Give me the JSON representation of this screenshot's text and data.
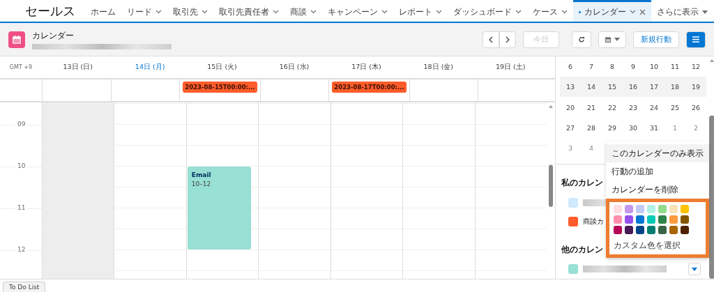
{
  "nav": {
    "app_name": "セールス",
    "items": [
      {
        "label": "ホーム",
        "has_menu": false,
        "selected": false
      },
      {
        "label": "リード",
        "has_menu": true,
        "selected": false
      },
      {
        "label": "取引先",
        "has_menu": true,
        "selected": false
      },
      {
        "label": "取引先責任者",
        "has_menu": true,
        "selected": false
      },
      {
        "label": "商談",
        "has_menu": true,
        "selected": false
      },
      {
        "label": "キャンペーン",
        "has_menu": true,
        "selected": false
      },
      {
        "label": "レポート",
        "has_menu": true,
        "selected": false
      },
      {
        "label": "ダッシュボード",
        "has_menu": true,
        "selected": false
      },
      {
        "label": "ケース",
        "has_menu": true,
        "selected": false
      },
      {
        "label": "カレンダー",
        "has_menu": true,
        "selected": true
      }
    ],
    "more": "さらに表示"
  },
  "header": {
    "title": "カレンダー",
    "today_button": {
      "label": "今日",
      "disabled": true
    },
    "new_button": "新規行動"
  },
  "calendar": {
    "timezone": "GMT +9",
    "days": [
      {
        "label": "13日 (日)",
        "today": false,
        "shaded": true
      },
      {
        "label": "14日 (月)",
        "today": true,
        "shaded": false
      },
      {
        "label": "15日 (火)",
        "today": false,
        "shaded": false,
        "all_day": [
          {
            "text": "2023-08-15T00:00:...",
            "color": "#fe5c2a"
          }
        ],
        "events": [
          {
            "title": "Email",
            "time": "10–12",
            "color": "#97e0d3"
          }
        ]
      },
      {
        "label": "16日 (水)",
        "today": false,
        "shaded": false
      },
      {
        "label": "17日 (木)",
        "today": false,
        "shaded": false,
        "all_day": [
          {
            "text": "2023-08-17T00:00:...",
            "color": "#fe5c2a"
          }
        ]
      },
      {
        "label": "18日 (金)",
        "today": false,
        "shaded": false
      },
      {
        "label": "19日 (土)",
        "today": false,
        "shaded": false
      }
    ],
    "hours": [
      "09",
      "10",
      "11",
      "12"
    ]
  },
  "sidebar": {
    "weeks": [
      {
        "selected": false,
        "days": [
          {
            "label": "6",
            "muted": false
          },
          {
            "label": "7",
            "muted": false
          },
          {
            "label": "8",
            "muted": false
          },
          {
            "label": "9",
            "muted": false
          },
          {
            "label": "10",
            "muted": false
          },
          {
            "label": "11",
            "muted": false
          },
          {
            "label": "12",
            "muted": false
          }
        ]
      },
      {
        "selected": true,
        "days": [
          {
            "label": "13",
            "muted": false
          },
          {
            "label": "14",
            "muted": false
          },
          {
            "label": "15",
            "muted": false
          },
          {
            "label": "16",
            "muted": false
          },
          {
            "label": "17",
            "muted": false
          },
          {
            "label": "18",
            "muted": false
          },
          {
            "label": "19",
            "muted": false
          }
        ]
      },
      {
        "selected": false,
        "days": [
          {
            "label": "20",
            "muted": false
          },
          {
            "label": "21",
            "muted": false
          },
          {
            "label": "22",
            "muted": false
          },
          {
            "label": "23",
            "muted": false
          },
          {
            "label": "24",
            "muted": false
          },
          {
            "label": "25",
            "muted": false
          },
          {
            "label": "26",
            "muted": false
          }
        ]
      },
      {
        "selected": false,
        "days": [
          {
            "label": "27",
            "muted": false
          },
          {
            "label": "28",
            "muted": false
          },
          {
            "label": "29",
            "muted": false
          },
          {
            "label": "30",
            "muted": false
          },
          {
            "label": "31",
            "muted": false
          },
          {
            "label": "1",
            "muted": true
          },
          {
            "label": "2",
            "muted": true
          }
        ]
      },
      {
        "selected": false,
        "days": [
          {
            "label": "3",
            "muted": true
          },
          {
            "label": "4",
            "muted": true
          }
        ]
      }
    ],
    "my_calendars": {
      "title": "私のカレン",
      "items": [
        {
          "color": "#cfe9fe"
        },
        {
          "name": "商談カ",
          "color": "#fe5c2a"
        }
      ]
    },
    "other_calendars": {
      "title": "他のカレン",
      "items": [
        {
          "color": "#97e0d3"
        }
      ]
    }
  },
  "menu": {
    "items": [
      {
        "label": "このカレンダーのみ表示",
        "selected": true
      },
      {
        "label": "行動の追加",
        "selected": false
      },
      {
        "label": "カレンダーを削除",
        "selected": false
      }
    ],
    "colors": [
      {
        "color": "#ffdde1"
      },
      {
        "color": "#c398ed"
      },
      {
        "color": "#c2c9f5"
      },
      {
        "color": "#b1f1e4"
      },
      {
        "color": "#91db8b"
      },
      {
        "color": "#f9e3b6"
      },
      {
        "color": "#ffc100"
      },
      {
        "color": "#ff8fae"
      },
      {
        "color": "#9550ea"
      },
      {
        "color": "#0176d3"
      },
      {
        "color": "#06c9b8"
      },
      {
        "color": "#2e844a"
      },
      {
        "color": "#ff9a3c"
      },
      {
        "color": "#845500"
      },
      {
        "color": "#b60554"
      },
      {
        "color": "#481a54"
      },
      {
        "color": "#014486"
      },
      {
        "color": "#047e70"
      },
      {
        "color": "#396547"
      },
      {
        "color": "#a96404"
      },
      {
        "color": "#4f2100"
      }
    ],
    "custom": "カスタム色を選択"
  },
  "footer": {
    "tab": "To Do List"
  }
}
